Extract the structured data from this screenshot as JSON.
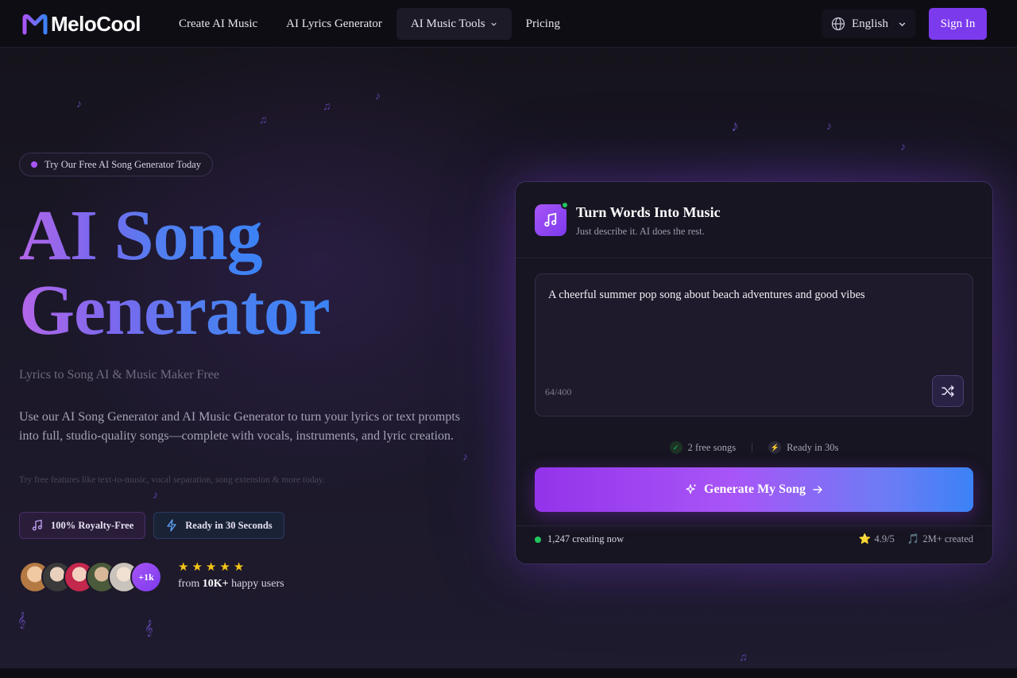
{
  "header": {
    "logo": {
      "text": "MeloCool"
    },
    "nav": [
      {
        "label": "Create AI Music"
      },
      {
        "label": "AI Lyrics Generator"
      },
      {
        "label": "AI Music Tools"
      },
      {
        "label": "Pricing"
      }
    ],
    "language": "English",
    "sign_in": "Sign In"
  },
  "hero": {
    "pill": "Try Our Free AI Song Generator Today",
    "title_line1": "AI Song",
    "title_line2": "Generator",
    "subtitle": "Lyrics to Song AI & Music Maker Free",
    "description": "Use our AI Song Generator and AI Music Generator to turn your lyrics or text prompts into full, studio-quality songs—complete with vocals, instruments, and lyric creation.",
    "small_note": "Try free features like text-to-music, vocal separation, song extension & more today.",
    "badges": [
      {
        "label": "100% Royalty-Free",
        "icon": "music-note-icon"
      },
      {
        "label": "Ready in 30 Seconds",
        "icon": "lightning-icon"
      }
    ],
    "avatars_more": "+1k",
    "stars": 5,
    "happy_prefix": "from ",
    "happy_count": "10K+",
    "happy_suffix": " happy users"
  },
  "card": {
    "title": "Turn Words Into Music",
    "subtitle": "Just describe it. AI does the rest.",
    "prompt_value": "A cheerful summer pop song about beach adventures and good vibes",
    "counter": "64/400",
    "meta_free": "2 free songs",
    "meta_ready": "Ready in 30s",
    "generate_label": "Generate My Song",
    "creating_now": "1,247 creating now",
    "rating": "4.9/5",
    "created": "2M+ created"
  },
  "colors": {
    "accent": "#7c3aed",
    "gradient_start": "#9333ea",
    "gradient_end": "#3b82f6",
    "online": "#22c55e",
    "star": "#f5c518"
  }
}
